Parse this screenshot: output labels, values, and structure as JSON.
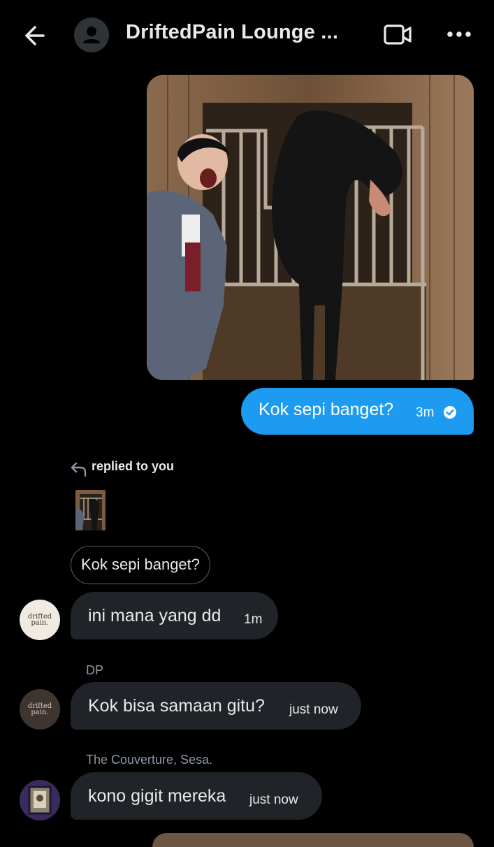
{
  "header": {
    "title": "DriftedPain Lounge ...",
    "icons": [
      "back-arrow-icon",
      "group-avatar-icon",
      "video-call-icon",
      "more-options-icon"
    ]
  },
  "messages": {
    "outgoing": {
      "text": "Kok sepi banget?",
      "time": "3m",
      "status_icon": "sent-check-icon"
    },
    "reply_context": {
      "label": "replied to you",
      "quoted_text": "Kok sepi banget?"
    },
    "incoming": [
      {
        "sender": "",
        "text": "ini mana yang dd",
        "time": "1m",
        "avatar_text": "drifted pain."
      },
      {
        "sender": "DP",
        "text": "Kok bisa samaan gitu?",
        "time": "just now",
        "avatar_text": "drifted pain."
      },
      {
        "sender": "The Couverture, Sesa.",
        "text": "kono gigit mereka",
        "time": "just now",
        "avatar_text": ""
      }
    ]
  },
  "colors": {
    "background": "#000000",
    "accent_blue": "#1d9bf0",
    "incoming_bubble": "#202327",
    "muted_text": "#8b98a5"
  }
}
